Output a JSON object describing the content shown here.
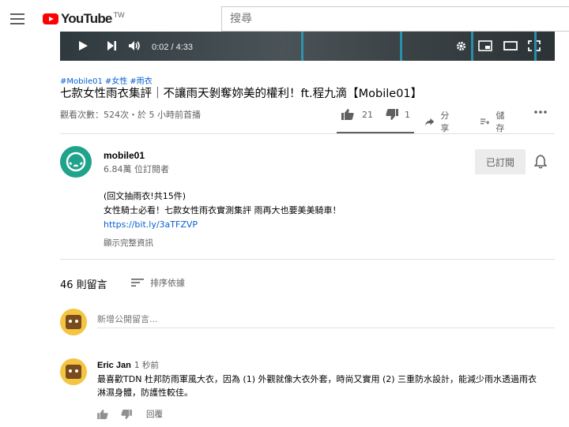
{
  "masthead": {
    "logo_text": "YouTube",
    "logo_region": "TW",
    "search_placeholder": "搜尋"
  },
  "player": {
    "time": "0:02 / 4:33"
  },
  "video": {
    "tags": [
      "#Mobile01",
      "#女性",
      "#雨衣"
    ],
    "title": "七款女性雨衣集評｜不讓雨天剝奪妳美的權利！ft.程九滴【Mobile01】",
    "views": "觀看次數：524次・於 5 小時前首播",
    "likes": "21",
    "dislikes": "1",
    "share_label": "分享",
    "save_label": "儲存"
  },
  "channel": {
    "name": "mobile01",
    "subscribers": "6.84萬 位訂閱者",
    "subscribed_label": "已訂閱"
  },
  "description": {
    "line1": "(回文抽雨衣!共15件)",
    "line2": "女性騎士必看！七款女性雨衣實測集評 雨再大也要美美騎車！",
    "link": "https://bit.ly/3aTFZVP",
    "show_more": "顯示完整資訊"
  },
  "comments": {
    "count_label": "46 則留言",
    "sort_label": "排序依據",
    "add_placeholder": "新增公開留言...",
    "items": [
      {
        "author": "Eric Jan",
        "time": "1 秒前",
        "text": "最喜歡TDN 杜邦防雨軍風大衣，因為 (1) 外觀就像大衣外套，時尚又實用 (2) 三重防水設計，能減少雨水透過雨衣淋濕身體，防護性較佳。",
        "reply_label": "回覆"
      }
    ]
  },
  "colors": {
    "brand_red": "#ff0000",
    "link_blue": "#065fd4",
    "channel_green": "#1fa38a"
  }
}
